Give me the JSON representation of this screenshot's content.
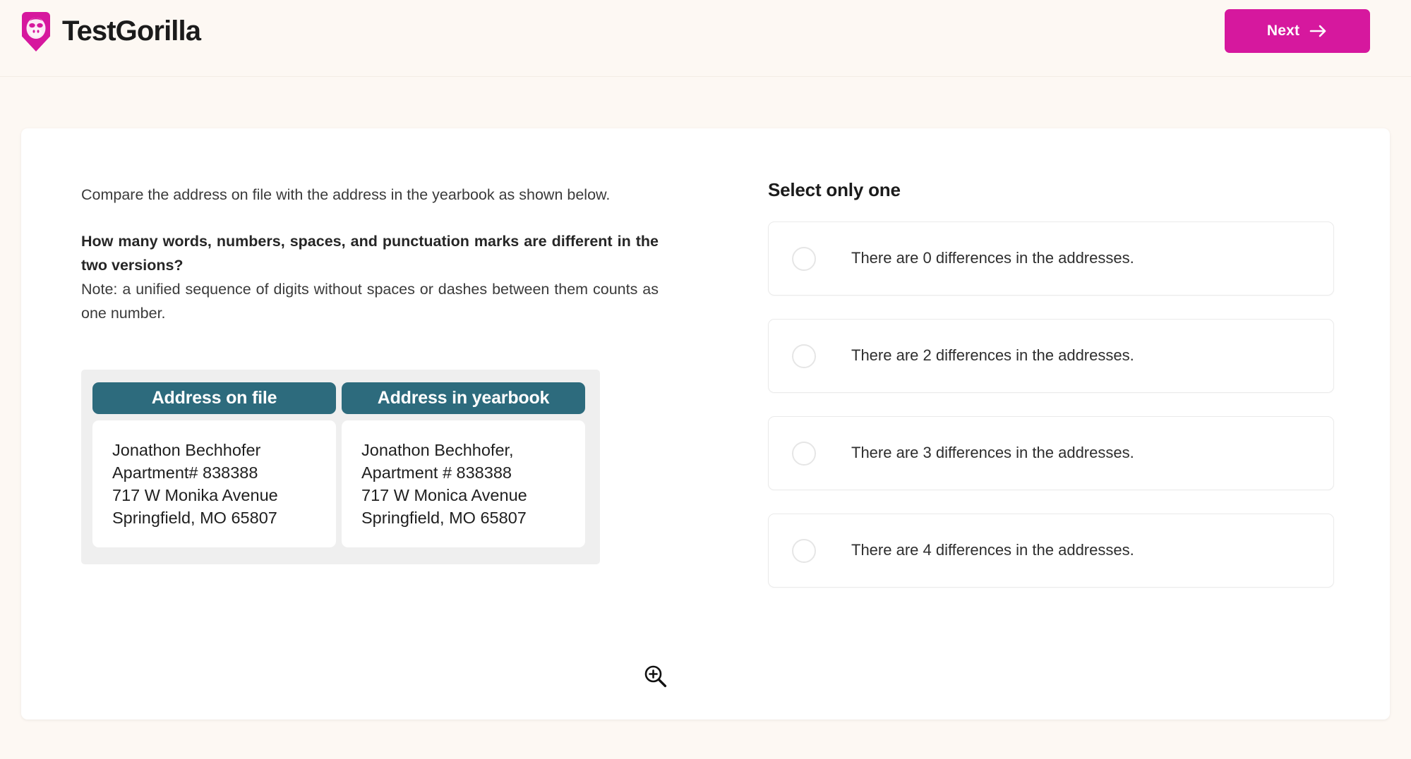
{
  "brand": {
    "name": "TestGorilla",
    "logo_icon": "gorilla-shield-logo",
    "accent_color": "#d6189e"
  },
  "header": {
    "next_label": "Next",
    "next_icon": "arrow-right-icon"
  },
  "question": {
    "intro": "Compare the address on file with the address in the yearbook as shown below.",
    "prompt": "How many words, numbers, spaces, and punctuation marks are different in the two versions?",
    "note": "Note: a unified sequence of digits without spaces or dashes between them counts as one number."
  },
  "compare": {
    "header_color": "#2d6b7d",
    "columns": [
      {
        "title": "Address on file",
        "lines": [
          "Jonathon Bechhofer",
          "Apartment# 838388",
          "717 W Monika Avenue",
          "Springfield, MO 65807"
        ]
      },
      {
        "title": "Address in yearbook",
        "lines": [
          "Jonathon Bechhofer,",
          "Apartment # 838388",
          "717 W Monica Avenue",
          "Springfield, MO 65807"
        ]
      }
    ],
    "zoom_icon": "magnifier-plus-icon"
  },
  "answers": {
    "title": "Select only one",
    "selected_index": null,
    "options": [
      {
        "label": "There are 0 differences in the addresses.",
        "selected": false
      },
      {
        "label": "There are 2 differences in the addresses.",
        "selected": false
      },
      {
        "label": "There are 3 differences in the addresses.",
        "selected": false
      },
      {
        "label": "There are 4 differences in the addresses.",
        "selected": false
      }
    ]
  }
}
